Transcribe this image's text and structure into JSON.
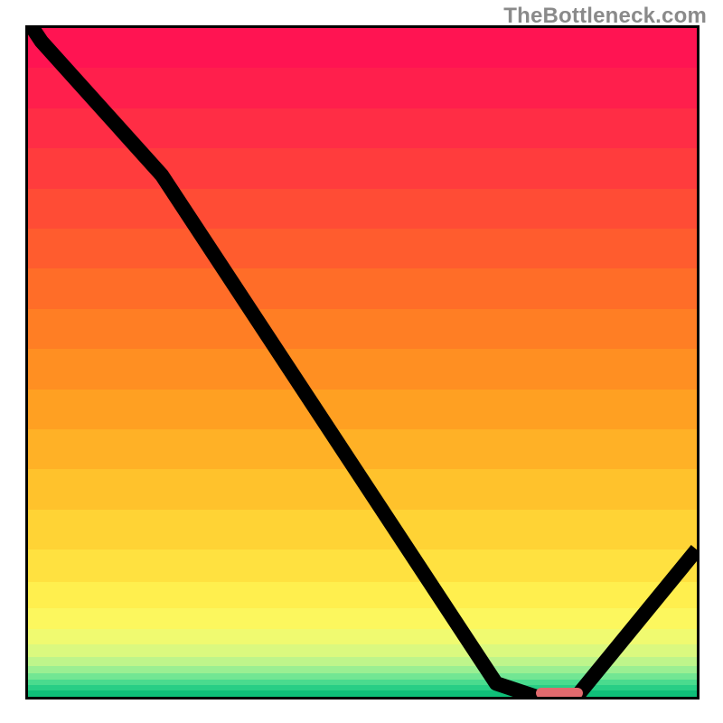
{
  "watermark": "TheBottleneck.com",
  "chart_data": {
    "type": "line",
    "x": [
      0,
      2,
      20,
      70,
      76,
      82,
      100
    ],
    "values": [
      101,
      98,
      78,
      2,
      0,
      0,
      22
    ],
    "xlim": [
      0,
      100
    ],
    "ylim": [
      0,
      100
    ],
    "title": "",
    "xlabel": "",
    "ylabel": "",
    "gradient": [
      {
        "y0": 0.0,
        "y1": 0.06,
        "color": "#ff1452"
      },
      {
        "y0": 0.06,
        "y1": 0.12,
        "color": "#ff1f4c"
      },
      {
        "y0": 0.12,
        "y1": 0.18,
        "color": "#ff2d45"
      },
      {
        "y0": 0.18,
        "y1": 0.24,
        "color": "#ff3c3d"
      },
      {
        "y0": 0.24,
        "y1": 0.3,
        "color": "#ff4c35"
      },
      {
        "y0": 0.3,
        "y1": 0.36,
        "color": "#ff5c2e"
      },
      {
        "y0": 0.36,
        "y1": 0.42,
        "color": "#ff6d28"
      },
      {
        "y0": 0.42,
        "y1": 0.48,
        "color": "#ff7e24"
      },
      {
        "y0": 0.48,
        "y1": 0.54,
        "color": "#ff8f22"
      },
      {
        "y0": 0.54,
        "y1": 0.6,
        "color": "#ffa022"
      },
      {
        "y0": 0.6,
        "y1": 0.66,
        "color": "#ffb126"
      },
      {
        "y0": 0.66,
        "y1": 0.72,
        "color": "#ffc22c"
      },
      {
        "y0": 0.72,
        "y1": 0.78,
        "color": "#ffd335"
      },
      {
        "y0": 0.78,
        "y1": 0.828,
        "color": "#ffe140"
      },
      {
        "y0": 0.828,
        "y1": 0.868,
        "color": "#ffef4e"
      },
      {
        "y0": 0.868,
        "y1": 0.898,
        "color": "#fcf75e"
      },
      {
        "y0": 0.898,
        "y1": 0.922,
        "color": "#f0fa70"
      },
      {
        "y0": 0.922,
        "y1": 0.94,
        "color": "#dbf97f"
      },
      {
        "y0": 0.94,
        "y1": 0.954,
        "color": "#bef58b"
      },
      {
        "y0": 0.954,
        "y1": 0.965,
        "color": "#9aef92"
      },
      {
        "y0": 0.965,
        "y1": 0.974,
        "color": "#72e693"
      },
      {
        "y0": 0.974,
        "y1": 0.982,
        "color": "#4adb8e"
      },
      {
        "y0": 0.982,
        "y1": 0.99,
        "color": "#28ce85"
      },
      {
        "y0": 0.99,
        "y1": 1.0,
        "color": "#0fbf79"
      }
    ],
    "marker": {
      "x0": 76,
      "x1": 83,
      "y": 0.5,
      "color": "#e16a6e"
    }
  }
}
